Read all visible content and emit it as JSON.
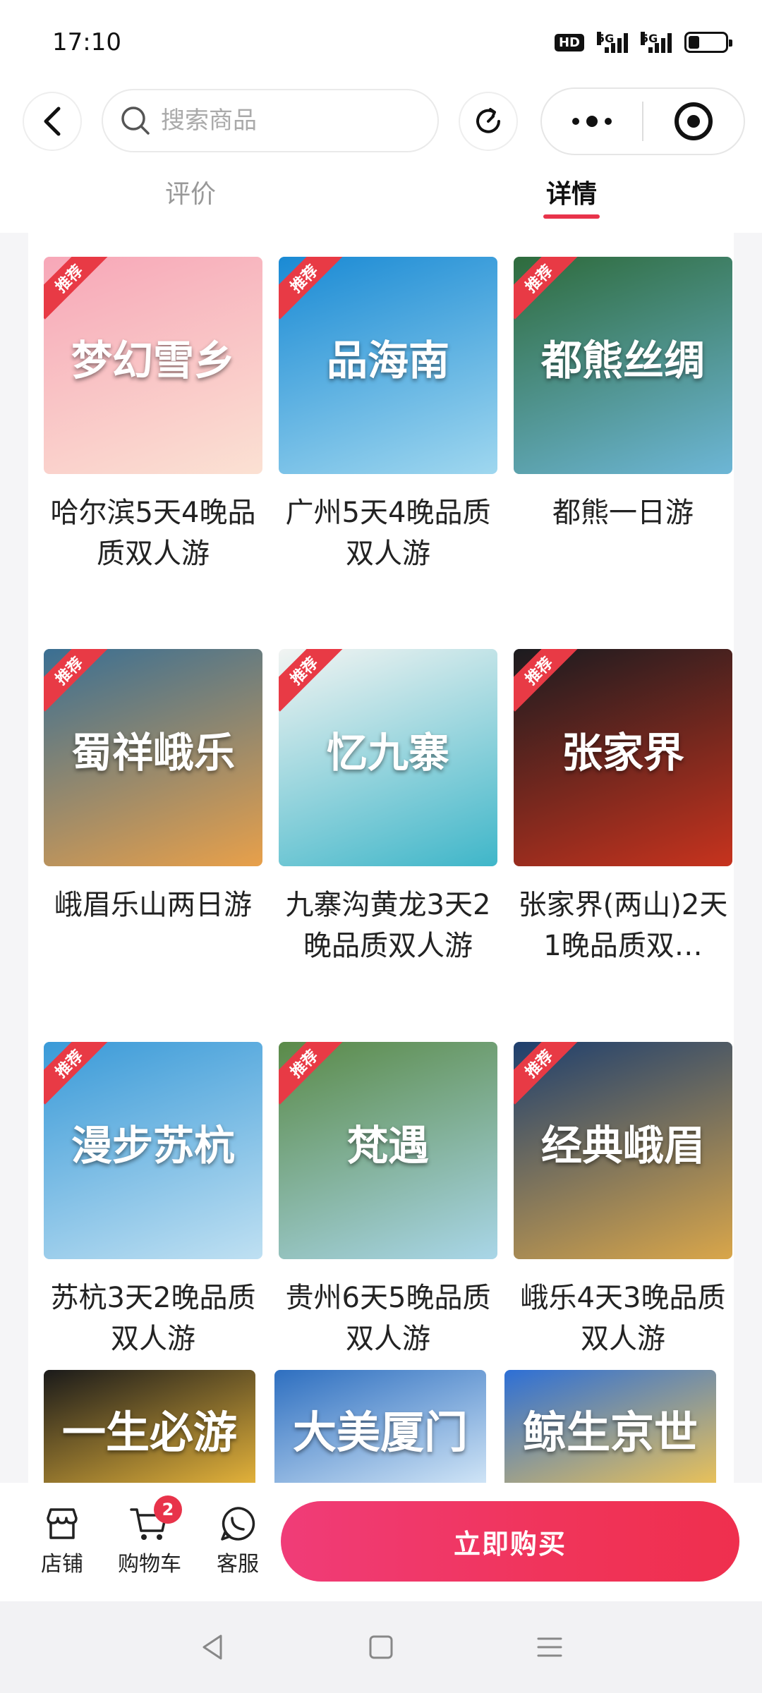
{
  "status_bar": {
    "time": "17:10",
    "hd_label": "HD",
    "network_1": "5G",
    "network_2": "5G",
    "battery_level": 0.3
  },
  "top_nav": {
    "search_placeholder": "搜索商品"
  },
  "tabs": {
    "reviews": "评价",
    "details": "详情",
    "active": "details"
  },
  "ribbon_label": "推荐",
  "products": [
    {
      "title": "哈尔滨5天4晚品质双人游",
      "image_text": "梦幻雪乡",
      "colors": [
        "#f7a7b8",
        "#fbe1d3"
      ]
    },
    {
      "title": "广州5天4晚品质双人游",
      "image_text": "品海南",
      "colors": [
        "#1a8ad4",
        "#9fd7ef"
      ]
    },
    {
      "title": "都熊一日游",
      "image_text": "都熊丝绸",
      "colors": [
        "#2e6b3c",
        "#6db6d6"
      ]
    },
    {
      "title": "峨眉乐山两日游",
      "image_text": "蜀祥峨乐",
      "colors": [
        "#3a6f93",
        "#e8a04a"
      ]
    },
    {
      "title": "九寨沟黄龙3天2晚品质双人游",
      "image_text": "忆九寨",
      "colors": [
        "#f2f4f2",
        "#3fb6c9"
      ]
    },
    {
      "title": "张家界(两山)2天1晚品质双…",
      "image_text": "张家界",
      "colors": [
        "#1b1b1f",
        "#c7331e"
      ]
    },
    {
      "title": "苏杭3天2晚品质双人游",
      "image_text": "漫步苏杭",
      "colors": [
        "#3a9ad8",
        "#bfe0f2"
      ]
    },
    {
      "title": "贵州6天5晚品质双人游",
      "image_text": "梵遇",
      "colors": [
        "#5a8a48",
        "#a9d6e8"
      ]
    },
    {
      "title": "峨乐4天3晚品质双人游",
      "image_text": "经典峨眉",
      "colors": [
        "#1e3f6e",
        "#d9a64a"
      ]
    }
  ],
  "partial_cards": [
    {
      "image_text": "一生必游",
      "colors": [
        "#1a1a1a",
        "#e2b13a"
      ]
    },
    {
      "image_text": "大美厦门",
      "colors": [
        "#2e6fc0",
        "#cfe4f6"
      ]
    },
    {
      "image_text": "鲸生京世",
      "colors": [
        "#2d6fd6",
        "#e8c15a"
      ]
    }
  ],
  "action_bar": {
    "shop": "店铺",
    "cart": "购物车",
    "cart_count": "2",
    "service": "客服",
    "buy_now": "立即购买",
    "buy_colors": [
      "#f03c78",
      "#ef2f4e"
    ]
  }
}
